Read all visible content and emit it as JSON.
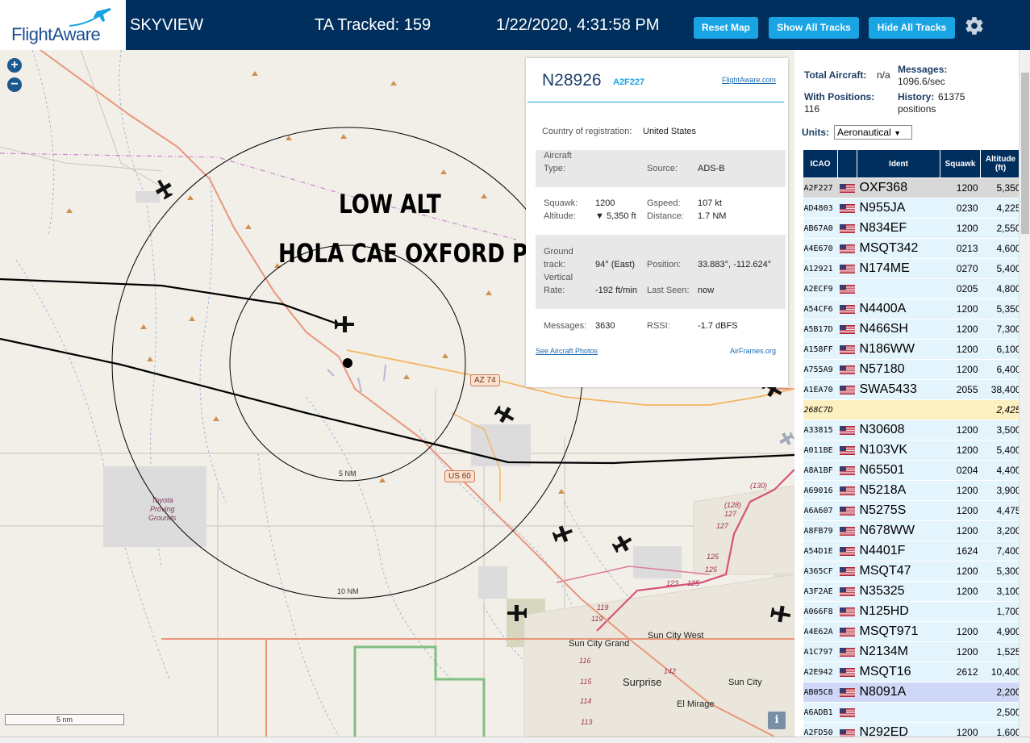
{
  "header": {
    "logo": "FlightAware",
    "app_title": "SKYVIEW",
    "ta_tracked": "TA Tracked: 159",
    "datetime": "1/22/2020, 4:31:58 PM",
    "reset_map": "Reset Map",
    "show_all_tracks": "Show All Tracks",
    "hide_all_tracks": "Hide All Tracks"
  },
  "map": {
    "zoom_in": "+",
    "zoom_out": "−",
    "overlay_line1": "LOW ALT",
    "overlay_line2": "HOLA CAE OXFORD PIGGIES",
    "ring_5": "5 NM",
    "ring_10": "10 NM",
    "scale": "5 nm",
    "road_az74": "AZ 74",
    "road_us60": "US 60",
    "toyota": "Toyota\nProving\nGrounds",
    "sun_city_grand": "Sun City Grand",
    "sun_city_west": "Sun City West",
    "surprise": "Surprise",
    "sun_city": "Sun City",
    "el_mirage": "El Mirage",
    "info": "i",
    "road_numbers": [
      "(130)",
      "(128)",
      "127",
      "127",
      "125",
      "125",
      "123",
      "125",
      "119",
      "119",
      "116",
      "115",
      "114",
      "113",
      "142"
    ]
  },
  "aircraft": {
    "ident": "N28926",
    "icao": "A2F227",
    "fa_link": "FlightAware.com",
    "country_label": "Country of registration:",
    "country": "United States",
    "type_label": "Aircraft Type:",
    "type_label_1": "Aircraft",
    "type_label_2": "Type:",
    "source_label": "Source:",
    "source": "ADS-B",
    "squawk_label": "Squawk:",
    "squawk": "1200",
    "gspeed_label": "Gspeed:",
    "gspeed": "107 kt",
    "altitude_label": "Altitude:",
    "altitude": "▼ 5,350 ft",
    "distance_label": "Distance:",
    "distance": "1.7 NM",
    "track_label": "Ground track:",
    "track_label_1": "Ground",
    "track_label_2": "track:",
    "track": "94° (East)",
    "position_label": "Position:",
    "position": "33.883°, -112.624°",
    "vrate_label": "Vertical Rate:",
    "vrate_label_1": "Vertical",
    "vrate_label_2": "Rate:",
    "vrate": "-192 ft/min",
    "lastseen_label": "Last Seen:",
    "lastseen": "now",
    "messages_label": "Messages:",
    "messages": "3630",
    "rssi_label": "RSSI:",
    "rssi": "-1.7 dBFS",
    "photos_link": "See Aircraft Photos",
    "airframes_link": "AirFrames.org"
  },
  "sidebar": {
    "total_label": "Total Aircraft:",
    "total": "n/a",
    "messages_label": "Messages:",
    "messages": "1096.6/sec",
    "positions_label": "With Positions:",
    "positions": "116",
    "history_label": "History:",
    "history": "61375 positions",
    "history_value": "61375",
    "history_unit": "positions",
    "units_label": "Units:",
    "units_value": "Aeronautical",
    "columns": [
      "ICAO",
      "",
      "Ident",
      "Squawk",
      "Altitude (ft)"
    ],
    "col_altitude_1": "Altitude",
    "col_altitude_2": "(ft)",
    "rows": [
      {
        "icao": "A2F227",
        "ident": "OXF368",
        "squawk": "1200",
        "alt": "5,350",
        "style": "sel"
      },
      {
        "icao": "AD4803",
        "ident": "N955JA",
        "squawk": "0230",
        "alt": "4,225",
        "style": ""
      },
      {
        "icao": "AB67A0",
        "ident": "N834EF",
        "squawk": "1200",
        "alt": "2,550",
        "style": ""
      },
      {
        "icao": "A4E670",
        "ident": "MSQT342",
        "squawk": "0213",
        "alt": "4,600",
        "style": ""
      },
      {
        "icao": "A12921",
        "ident": "N174ME",
        "squawk": "0270",
        "alt": "5,400",
        "style": ""
      },
      {
        "icao": "A2ECF9",
        "ident": "",
        "squawk": "0205",
        "alt": "4,800",
        "style": ""
      },
      {
        "icao": "A54CF6",
        "ident": "N4400A",
        "squawk": "1200",
        "alt": "5,350",
        "style": ""
      },
      {
        "icao": "A5B17D",
        "ident": "N466SH",
        "squawk": "1200",
        "alt": "7,300",
        "style": ""
      },
      {
        "icao": "A158FF",
        "ident": "N186WW",
        "squawk": "1200",
        "alt": "6,100",
        "style": ""
      },
      {
        "icao": "A755A9",
        "ident": "N57180",
        "squawk": "1200",
        "alt": "6,400",
        "style": ""
      },
      {
        "icao": "A1EA70",
        "ident": "SWA5433",
        "squawk": "2055",
        "alt": "38,400",
        "style": ""
      },
      {
        "icao": "268C7D",
        "ident": "",
        "squawk": "",
        "alt": "2,425",
        "style": "warn"
      },
      {
        "icao": "A33815",
        "ident": "N30608",
        "squawk": "1200",
        "alt": "3,500",
        "style": ""
      },
      {
        "icao": "A011BE",
        "ident": "N103VK",
        "squawk": "1200",
        "alt": "5,400",
        "style": ""
      },
      {
        "icao": "A8A1BF",
        "ident": "N65501",
        "squawk": "0204",
        "alt": "4,400",
        "style": ""
      },
      {
        "icao": "A69016",
        "ident": "N5218A",
        "squawk": "1200",
        "alt": "3,900",
        "style": ""
      },
      {
        "icao": "A6A607",
        "ident": "N5275S",
        "squawk": "1200",
        "alt": "4,475",
        "style": ""
      },
      {
        "icao": "A8FB79",
        "ident": "N678WW",
        "squawk": "1200",
        "alt": "3,200",
        "style": ""
      },
      {
        "icao": "A54D1E",
        "ident": "N4401F",
        "squawk": "1624",
        "alt": "7,400",
        "style": ""
      },
      {
        "icao": "A365CF",
        "ident": "MSQT47",
        "squawk": "1200",
        "alt": "5,300",
        "style": ""
      },
      {
        "icao": "A3F2AE",
        "ident": "N35325",
        "squawk": "1200",
        "alt": "3,100",
        "style": ""
      },
      {
        "icao": "A066F8",
        "ident": "N125HD",
        "squawk": "",
        "alt": "1,700",
        "style": ""
      },
      {
        "icao": "A4E62A",
        "ident": "MSQT971",
        "squawk": "1200",
        "alt": "4,900",
        "style": ""
      },
      {
        "icao": "A1C797",
        "ident": "N2134M",
        "squawk": "1200",
        "alt": "1,525",
        "style": ""
      },
      {
        "icao": "A2E942",
        "ident": "MSQT16",
        "squawk": "2612",
        "alt": "10,400",
        "style": ""
      },
      {
        "icao": "AB05C8",
        "ident": "N8091A",
        "squawk": "",
        "alt": "2,200",
        "style": "hl"
      },
      {
        "icao": "A6ADB1",
        "ident": "",
        "squawk": "",
        "alt": "2,500",
        "style": ""
      },
      {
        "icao": "A2FD50",
        "ident": "N292ED",
        "squawk": "1200",
        "alt": "1,600",
        "style": ""
      }
    ]
  },
  "colors": {
    "header_bg": "#002f5d",
    "button": "#19a4e4",
    "table_row": "#e4f4fc",
    "selected_row": "#d8d8d8",
    "highlight_row": "#cfd7f7",
    "warn_row": "#fdf0c0",
    "map_bg": "#f2efe9",
    "highway": "#e9977a",
    "az74": "#f5b460",
    "track": "#000000"
  },
  "icons": {
    "gear": "gear-icon",
    "plane": "airplane-icon",
    "flag": "us-flag-icon"
  }
}
